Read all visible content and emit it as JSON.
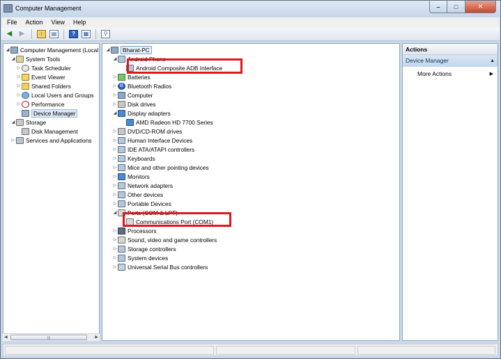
{
  "window": {
    "title": "Computer Management"
  },
  "menubar": {
    "items": [
      "File",
      "Action",
      "View",
      "Help"
    ]
  },
  "toolbar": {
    "buttons": [
      "back-icon",
      "forward-icon",
      "up-folder-icon",
      "show-hide-tree-icon",
      "help-icon",
      "properties-icon",
      "scan-hardware-icon"
    ]
  },
  "tree": {
    "root": "Computer Management (Local",
    "system_tools": "System Tools",
    "task_scheduler": "Task Scheduler",
    "event_viewer": "Event Viewer",
    "shared_folders": "Shared Folders",
    "local_users": "Local Users and Groups",
    "performance": "Performance",
    "device_manager": "Device Manager",
    "storage": "Storage",
    "disk_management": "Disk Management",
    "services": "Services and Applications"
  },
  "devices": {
    "computer_name": "Bharat-PC",
    "categories": [
      {
        "label": "Android Phone",
        "icon": "phone-icon",
        "expanded": true
      },
      {
        "label": "Android Composite ADB Interface",
        "icon": "device-icon",
        "child": true
      },
      {
        "label": "Batteries",
        "icon": "battery-icon"
      },
      {
        "label": "Bluetooth Radios",
        "icon": "bluetooth-icon"
      },
      {
        "label": "Computer",
        "icon": "computer-icon"
      },
      {
        "label": "Disk drives",
        "icon": "disk-drive-icon"
      },
      {
        "label": "Display adapters",
        "icon": "display-icon",
        "expanded": true
      },
      {
        "label": "AMD Radeon HD 7700 Series",
        "icon": "display-adapter-icon",
        "child": true
      },
      {
        "label": "DVD/CD-ROM drives",
        "icon": "dvd-icon"
      },
      {
        "label": "Human Interface Devices",
        "icon": "hid-icon"
      },
      {
        "label": "IDE ATA/ATAPI controllers",
        "icon": "ide-icon"
      },
      {
        "label": "Keyboards",
        "icon": "keyboard-icon"
      },
      {
        "label": "Mice and other pointing devices",
        "icon": "mouse-icon"
      },
      {
        "label": "Monitors",
        "icon": "monitor-icon"
      },
      {
        "label": "Network adapters",
        "icon": "network-icon"
      },
      {
        "label": "Other devices",
        "icon": "other-devices-icon"
      },
      {
        "label": "Portable Devices",
        "icon": "portable-icon"
      },
      {
        "label": "Ports (COM & LPT)",
        "icon": "port-icon",
        "expanded": true
      },
      {
        "label": "Communications Port (COM1)",
        "icon": "com-port-icon",
        "child": true
      },
      {
        "label": "Processors",
        "icon": "processor-icon"
      },
      {
        "label": "Sound, video and game controllers",
        "icon": "sound-icon"
      },
      {
        "label": "Storage controllers",
        "icon": "storage-controller-icon"
      },
      {
        "label": "System devices",
        "icon": "system-devices-icon"
      },
      {
        "label": "Universal Serial Bus controllers",
        "icon": "usb-icon"
      }
    ]
  },
  "actions": {
    "header": "Actions",
    "section": "Device Manager",
    "more": "More Actions"
  },
  "colors": {
    "highlight": "#e0161b",
    "selection": "#dde9f6"
  }
}
